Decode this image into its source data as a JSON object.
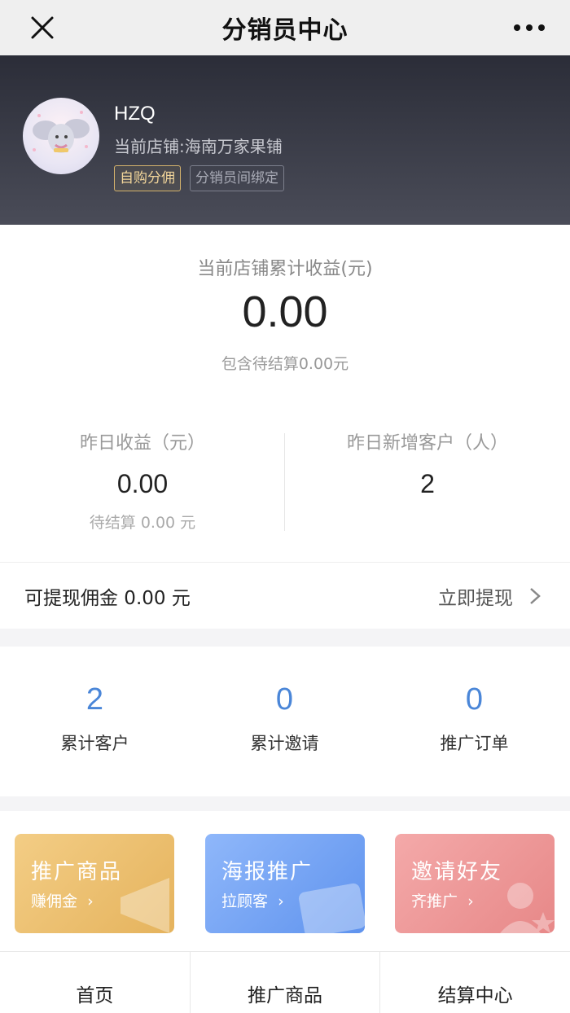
{
  "nav": {
    "title": "分销员中心",
    "close_icon": "close-icon",
    "more_icon": "more-dots-icon"
  },
  "profile": {
    "username": "HZQ",
    "shop": "当前店铺:海南万家果铺",
    "tags": [
      "自购分佣",
      "分销员间绑定"
    ]
  },
  "earnings": {
    "total_label": "当前店铺累计收益(元)",
    "total_value": "0.00",
    "pending_text": "包含待结算0.00元",
    "yesterday": {
      "label": "昨日收益（元）",
      "value": "0.00",
      "sub": "待结算 0.00 元"
    },
    "new_customers": {
      "label": "昨日新增客户（人）",
      "value": "2"
    },
    "withdraw": {
      "label": "可提现佣金 0.00 元",
      "action": "立即提现"
    }
  },
  "stats": [
    {
      "value": "2",
      "label": "累计客户"
    },
    {
      "value": "0",
      "label": "累计邀请"
    },
    {
      "value": "0",
      "label": "推广订单"
    }
  ],
  "promos": [
    {
      "title": "推广商品",
      "sub": "赚佣金",
      "icon": "megaphone-icon"
    },
    {
      "title": "海报推广",
      "sub": "拉顾客",
      "icon": "poster-card-icon"
    },
    {
      "title": "邀请好友",
      "sub": "齐推广",
      "icon": "person-star-icon"
    }
  ],
  "tabs": [
    "首页",
    "推广商品",
    "结算中心"
  ],
  "colors": {
    "accent_blue": "#4a86d8",
    "header_dark": "#2b2d38",
    "tag_gold": "#f2d59a"
  }
}
